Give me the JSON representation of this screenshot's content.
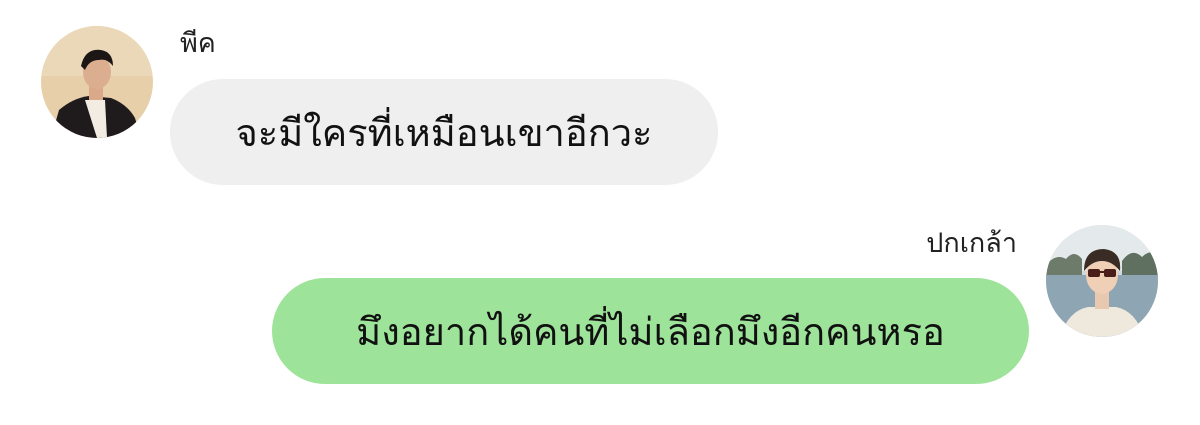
{
  "messages": [
    {
      "side": "left",
      "sender": "พีค",
      "text": "จะมีใครที่เหมือนเขาอีกวะ",
      "bubble_color": "#efefef"
    },
    {
      "side": "right",
      "sender": "ปกเกล้า",
      "text": "มึงอยากได้คนที่ไม่เลือกมึงอีกคนหรอ",
      "bubble_color": "#9ee39a"
    }
  ]
}
